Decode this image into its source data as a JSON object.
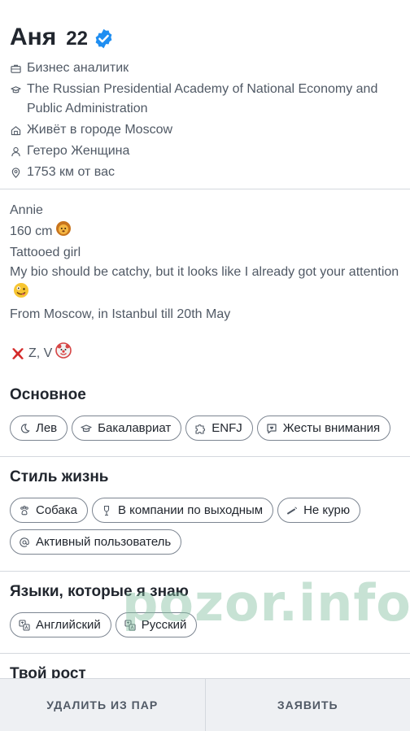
{
  "profile": {
    "name": "Аня",
    "age": "22",
    "info": [
      {
        "icon": "briefcase-icon",
        "text": "Бизнес аналитик"
      },
      {
        "icon": "graduation-cap-icon",
        "text": "The Russian Presidential Academy of National Economy and Public Administration"
      },
      {
        "icon": "home-icon",
        "text": "Живёт в городе Moscow"
      },
      {
        "icon": "person-icon",
        "text": "Гетеро Женщина"
      },
      {
        "icon": "location-pin-icon",
        "text": "1753 км от вас"
      }
    ]
  },
  "bio": {
    "lines": [
      "Annie",
      "160 cm",
      "Tattooed girl",
      "My bio should be catchy, but it looks like I already got your attention",
      "From Moscow, in Istanbul till 20th May"
    ],
    "last_line": "Z, V"
  },
  "sections": {
    "basics": {
      "title": "Основное",
      "chips": [
        {
          "icon": "moon-icon",
          "label": "Лев"
        },
        {
          "icon": "graduation-cap-icon",
          "label": "Бакалавриат"
        },
        {
          "icon": "puzzle-icon",
          "label": "ENFJ"
        },
        {
          "icon": "message-heart-icon",
          "label": "Жесты внимания"
        }
      ]
    },
    "lifestyle": {
      "title": "Стиль жизнь",
      "chips": [
        {
          "icon": "paw-icon",
          "label": "Собака"
        },
        {
          "icon": "wine-glass-icon",
          "label": "В компании по выходным"
        },
        {
          "icon": "cigarette-icon",
          "label": "Не курю"
        },
        {
          "icon": "at-icon",
          "label": "Активный пользователь"
        }
      ]
    },
    "languages": {
      "title": "Языки, которые я знаю",
      "chips": [
        {
          "icon": "translate-icon",
          "label": "Английский"
        },
        {
          "icon": "translate-icon",
          "label": "Русский"
        }
      ]
    },
    "height": {
      "title": "Твой рост"
    }
  },
  "watermark": "pozor.info",
  "actions": {
    "unmatch": "УДАЛИТЬ ИЗ ПАР",
    "report": "ЗАЯВИТЬ"
  },
  "colors": {
    "verified": "#1f8ef1",
    "text": "#21262e",
    "muted": "#505965"
  }
}
